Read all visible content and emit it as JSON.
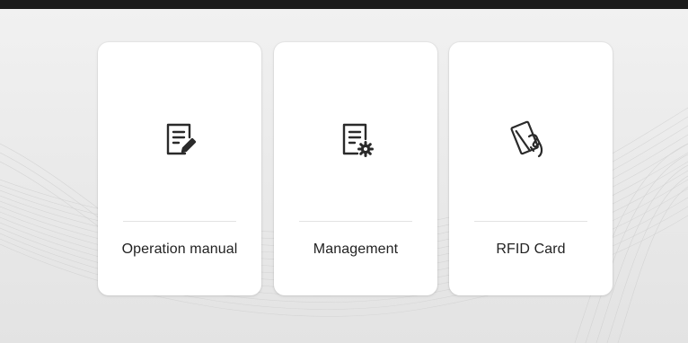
{
  "colors": {
    "top_bar": "#1b1b1b",
    "card_background": "#ffffff",
    "label_text": "#222222",
    "icon_stroke": "#2a2a2a",
    "divider": "#e2e2e2"
  },
  "cards": [
    {
      "label": "Operation manual",
      "icon": "document-edit-icon"
    },
    {
      "label": "Management",
      "icon": "document-settings-icon"
    },
    {
      "label": "RFID Card",
      "icon": "hand-card-icon"
    }
  ]
}
